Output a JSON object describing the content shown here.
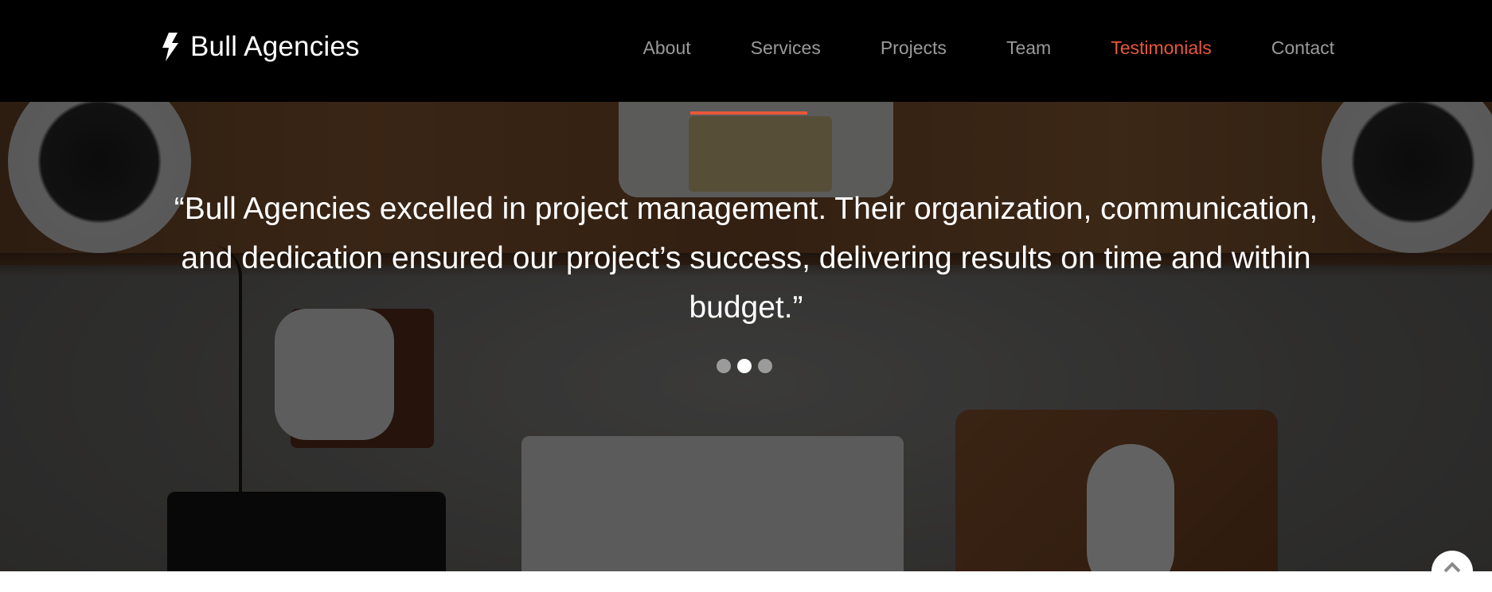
{
  "brand": {
    "name": "Bull Agencies",
    "icon": "lightning-bolt-icon"
  },
  "nav": {
    "items": [
      {
        "label": "About",
        "active": false
      },
      {
        "label": "Services",
        "active": false
      },
      {
        "label": "Projects",
        "active": false
      },
      {
        "label": "Team",
        "active": false
      },
      {
        "label": "Testimonials",
        "active": true
      },
      {
        "label": "Contact",
        "active": false
      }
    ]
  },
  "testimonial": {
    "quote": "“Bull Agencies excelled in project management. Their organization, communication, and dedication ensured our project’s success, delivering results on time and within budget.”",
    "slides": 3,
    "active_slide": 2
  },
  "scroll_top": {
    "icon": "chevron-up-icon"
  },
  "colors": {
    "accent": "#e8573a",
    "header_bg": "#000000",
    "nav_text": "#9a9a9a",
    "text": "#ffffff"
  }
}
